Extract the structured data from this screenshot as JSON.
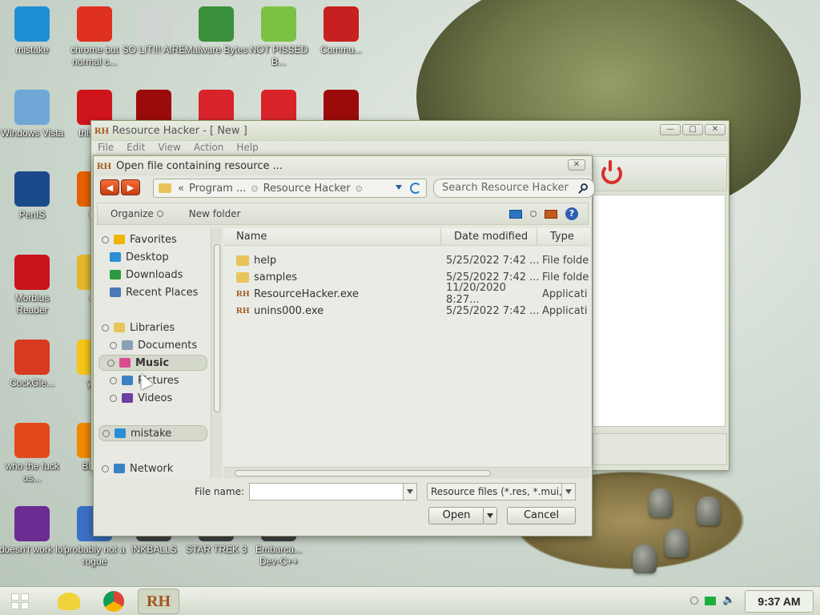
{
  "desktop_icons": [
    {
      "label": "mistake",
      "icon": "monitor-icon",
      "color": "#1f8fd6"
    },
    {
      "label": "chrome but normal c...",
      "icon": "chrome-icon",
      "color": "#e0301e"
    },
    {
      "label": "SO LIT!!! AIRE",
      "icon": "solitaire-icon",
      "color": "#cfd4d0"
    },
    {
      "label": "Malware Bytes",
      "icon": "shield-check-icon",
      "color": "#3a8f3a"
    },
    {
      "label": "NOT PISSED B...",
      "icon": "bad-piggies-icon",
      "color": "#7cc242"
    },
    {
      "label": "Commu...",
      "icon": "communist-icon",
      "color": "#c82020"
    },
    {
      "label": "Windows Vista",
      "icon": "recycle-bin-icon",
      "color": "#6fa7d6"
    },
    {
      "label": "this like",
      "icon": "opera-icon",
      "color": "#d0141c"
    },
    {
      "label": "",
      "icon": "flash-icon",
      "color": "#9b0b0b"
    },
    {
      "label": "",
      "icon": "angry-birds-icon",
      "color": "#d8232a"
    },
    {
      "label": "",
      "icon": "angry-birds-icon",
      "color": "#d8232a"
    },
    {
      "label": "",
      "icon": "flash-icon",
      "color": "#9b0b0b"
    },
    {
      "label": "PenIS",
      "icon": "photoshop-icon",
      "color": "#1b4a8a"
    },
    {
      "label": "fur",
      "icon": "firefox-icon",
      "color": "#e66000"
    },
    {
      "label": "Morbius Reader",
      "icon": "adobe-reader-icon",
      "color": "#c8141c"
    },
    {
      "label": "cd",
      "icon": "cd-icon",
      "color": "#e3b629"
    },
    {
      "label": "CockGle...",
      "icon": "ccleaner-icon",
      "color": "#d73a1e"
    },
    {
      "label": "you",
      "icon": "star-icon",
      "color": "#f5c518"
    },
    {
      "label": "who the fuck us...",
      "icon": "flash-player-icon",
      "color": "#e24a1b"
    },
    {
      "label": "BEEF",
      "icon": "vlc-icon",
      "color": "#f08a00"
    },
    {
      "label": "doesn't work lol",
      "icon": "yahoo-messenger-icon",
      "color": "#6a2c91"
    },
    {
      "label": "probably not a rogue",
      "icon": "installer-icon",
      "color": "#3b6fc4"
    },
    {
      "label": "INKBALLS",
      "icon": "inkball-icon",
      "color": "#444"
    },
    {
      "label": "STAR TREK 3",
      "icon": "startrek-icon",
      "color": "#444"
    },
    {
      "label": "Embarca... Dev-C++",
      "icon": "devcpp-icon",
      "color": "#444"
    }
  ],
  "rh_window": {
    "logo": "RH",
    "title": "Resource Hacker - [ New ]",
    "menu": [
      "File",
      "Edit",
      "View",
      "Action",
      "Help"
    ]
  },
  "dialog": {
    "logo": "RH",
    "title": "Open file containing resource ...",
    "close_label": "✕",
    "address": {
      "prefix": "«",
      "parts": [
        "Program ...",
        "Resource Hacker"
      ]
    },
    "search_placeholder": "Search Resource Hacker",
    "organize_label": "Organize",
    "new_folder_label": "New folder",
    "nav": [
      {
        "label": "Favorites",
        "icon": "star-icon",
        "color": "#f0b400"
      },
      {
        "label": "Desktop",
        "icon": "desktop-icon",
        "color": "#2b8fd6"
      },
      {
        "label": "Downloads",
        "icon": "download-icon",
        "color": "#2a9a3c"
      },
      {
        "label": "Recent Places",
        "icon": "recent-places-icon",
        "color": "#4c78b8"
      },
      {
        "label": "Libraries",
        "icon": "folder-icon",
        "color": "#e8c45a"
      },
      {
        "label": "Documents",
        "icon": "documents-icon",
        "color": "#8aa0b8"
      },
      {
        "label": "Music",
        "icon": "music-icon",
        "color": "#d84c8f"
      },
      {
        "label": "Pictures",
        "icon": "pictures-icon",
        "color": "#3b82c4"
      },
      {
        "label": "Videos",
        "icon": "videos-icon",
        "color": "#6b3fa0"
      },
      {
        "label": "mistake",
        "icon": "computer-icon",
        "color": "#2b8fd6"
      },
      {
        "label": "Network",
        "icon": "network-icon",
        "color": "#3b82c4"
      }
    ],
    "columns": [
      "Name",
      "Date modified",
      "Type"
    ],
    "files": [
      {
        "name": "help",
        "date": "5/25/2022 7:42 ...",
        "type": "File folde",
        "kind": "folder"
      },
      {
        "name": "samples",
        "date": "5/25/2022 7:42 ...",
        "type": "File folde",
        "kind": "folder"
      },
      {
        "name": "ResourceHacker.exe",
        "date": "11/20/2020 8:27...",
        "type": "Applicati",
        "kind": "exe"
      },
      {
        "name": "unins000.exe",
        "date": "5/25/2022 7:42 ...",
        "type": "Applicati",
        "kind": "exe"
      }
    ],
    "file_name_label": "File name:",
    "file_name_value": "",
    "file_type_value": "Resource files (*.res, *.mui, *.",
    "open_label": "Open",
    "cancel_label": "Cancel"
  },
  "taskbar": {
    "clock": "9:37 AM",
    "items": [
      "contacts-icon",
      "chrome-icon",
      "resource-hacker-icon"
    ],
    "active_logo": "RH"
  },
  "colors": {
    "accent": "#2b74c5",
    "title_logo": "#a2571b",
    "power": "#d8302b"
  }
}
